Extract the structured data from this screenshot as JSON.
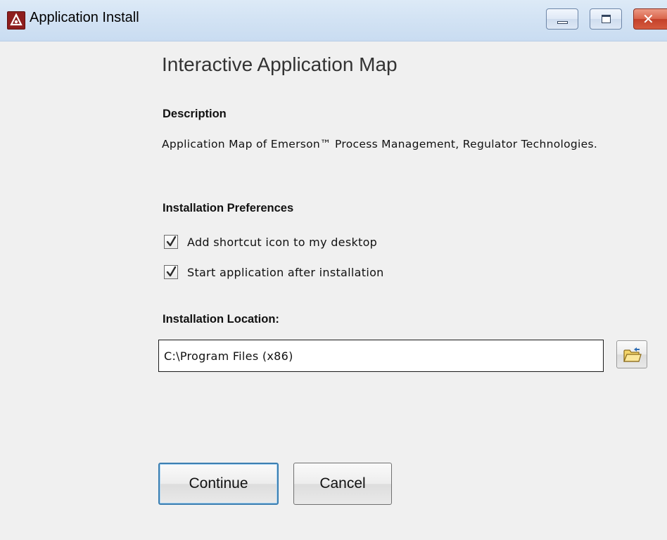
{
  "window": {
    "title": "Application Install",
    "icons": {
      "app": "app-logo-icon",
      "minimize": "minimize-icon",
      "maximize": "maximize-icon",
      "close": "close-icon"
    }
  },
  "main": {
    "heading": "Interactive Application Map",
    "description_label": "Description",
    "description_text": "Application Map of Emerson™ Process Management, Regulator Technologies.",
    "preferences_label": "Installation Preferences",
    "options": [
      {
        "label": "Add shortcut icon to my desktop",
        "checked": true
      },
      {
        "label": "Start application after installation",
        "checked": true
      }
    ],
    "location_label": "Installation Location:",
    "location_value": "C:\\Program Files (x86)",
    "browse_icon": "folder-open-icon"
  },
  "actions": {
    "continue_label": "Continue",
    "cancel_label": "Cancel"
  },
  "colors": {
    "titlebar": "#d3e3f4",
    "close_button": "#d9644b",
    "default_button_border": "#3c7fb1",
    "background": "#f0f0f0"
  }
}
